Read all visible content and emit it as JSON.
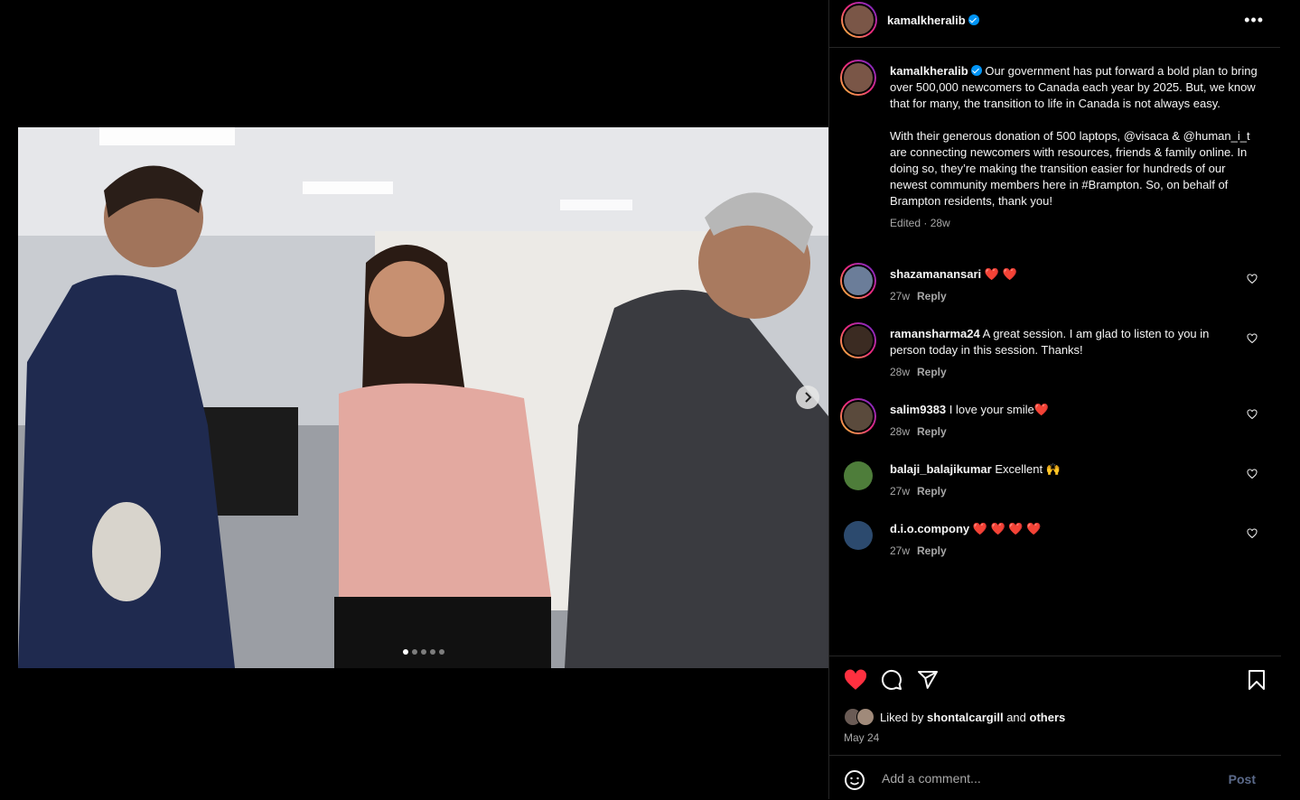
{
  "post": {
    "username": "kamalkheralib",
    "caption": "Our government has put forward a bold plan to bring over 500,000 newcomers to Canada each year by 2025. But, we know that for many, the transition to life in Canada is not always easy.\n\nWith their generous donation of 500 laptops, @visaca & @human_i_t are connecting newcomers with resources, friends & family online. In doing so, they’re making the transition easier for hundreds of our newest community members here in #Brampton. So, on behalf of Brampton residents, thank you!",
    "caption_meta": "Edited · 28w"
  },
  "comments": [
    {
      "user": "shazamanansari",
      "text": "❤️ ❤️",
      "time": "27w",
      "reply": "Reply"
    },
    {
      "user": "ramansharma24",
      "text": "A great session. I am glad to listen to you in person today in this session. Thanks!",
      "time": "28w",
      "reply": "Reply"
    },
    {
      "user": "salim9383",
      "text": "I love your smile❤️",
      "time": "28w",
      "reply": "Reply"
    },
    {
      "user": "balaji_balajikumar",
      "text": "Excellent 🙌",
      "time": "27w",
      "reply": "Reply"
    },
    {
      "user": "d.i.o.compony",
      "text": "❤️ ❤️ ❤️ ❤️",
      "time": "27w",
      "reply": "Reply"
    }
  ],
  "likes": {
    "prefix": "Liked by",
    "user": "shontalcargill",
    "and": "and",
    "others": "others"
  },
  "date": "May 24",
  "add_comment": {
    "placeholder": "Add a comment...",
    "post_label": "Post"
  },
  "carousel": {
    "total": 5,
    "active": 1
  },
  "colors": {
    "like_red": "#ff3040",
    "verified_blue": "#0095f6",
    "post_disabled": "#5b6a8a"
  },
  "icons": [
    "more-icon",
    "heart-icon",
    "comment-icon",
    "share-icon",
    "bookmark-icon",
    "emoji-icon",
    "chevron-right-icon",
    "verified-icon"
  ]
}
